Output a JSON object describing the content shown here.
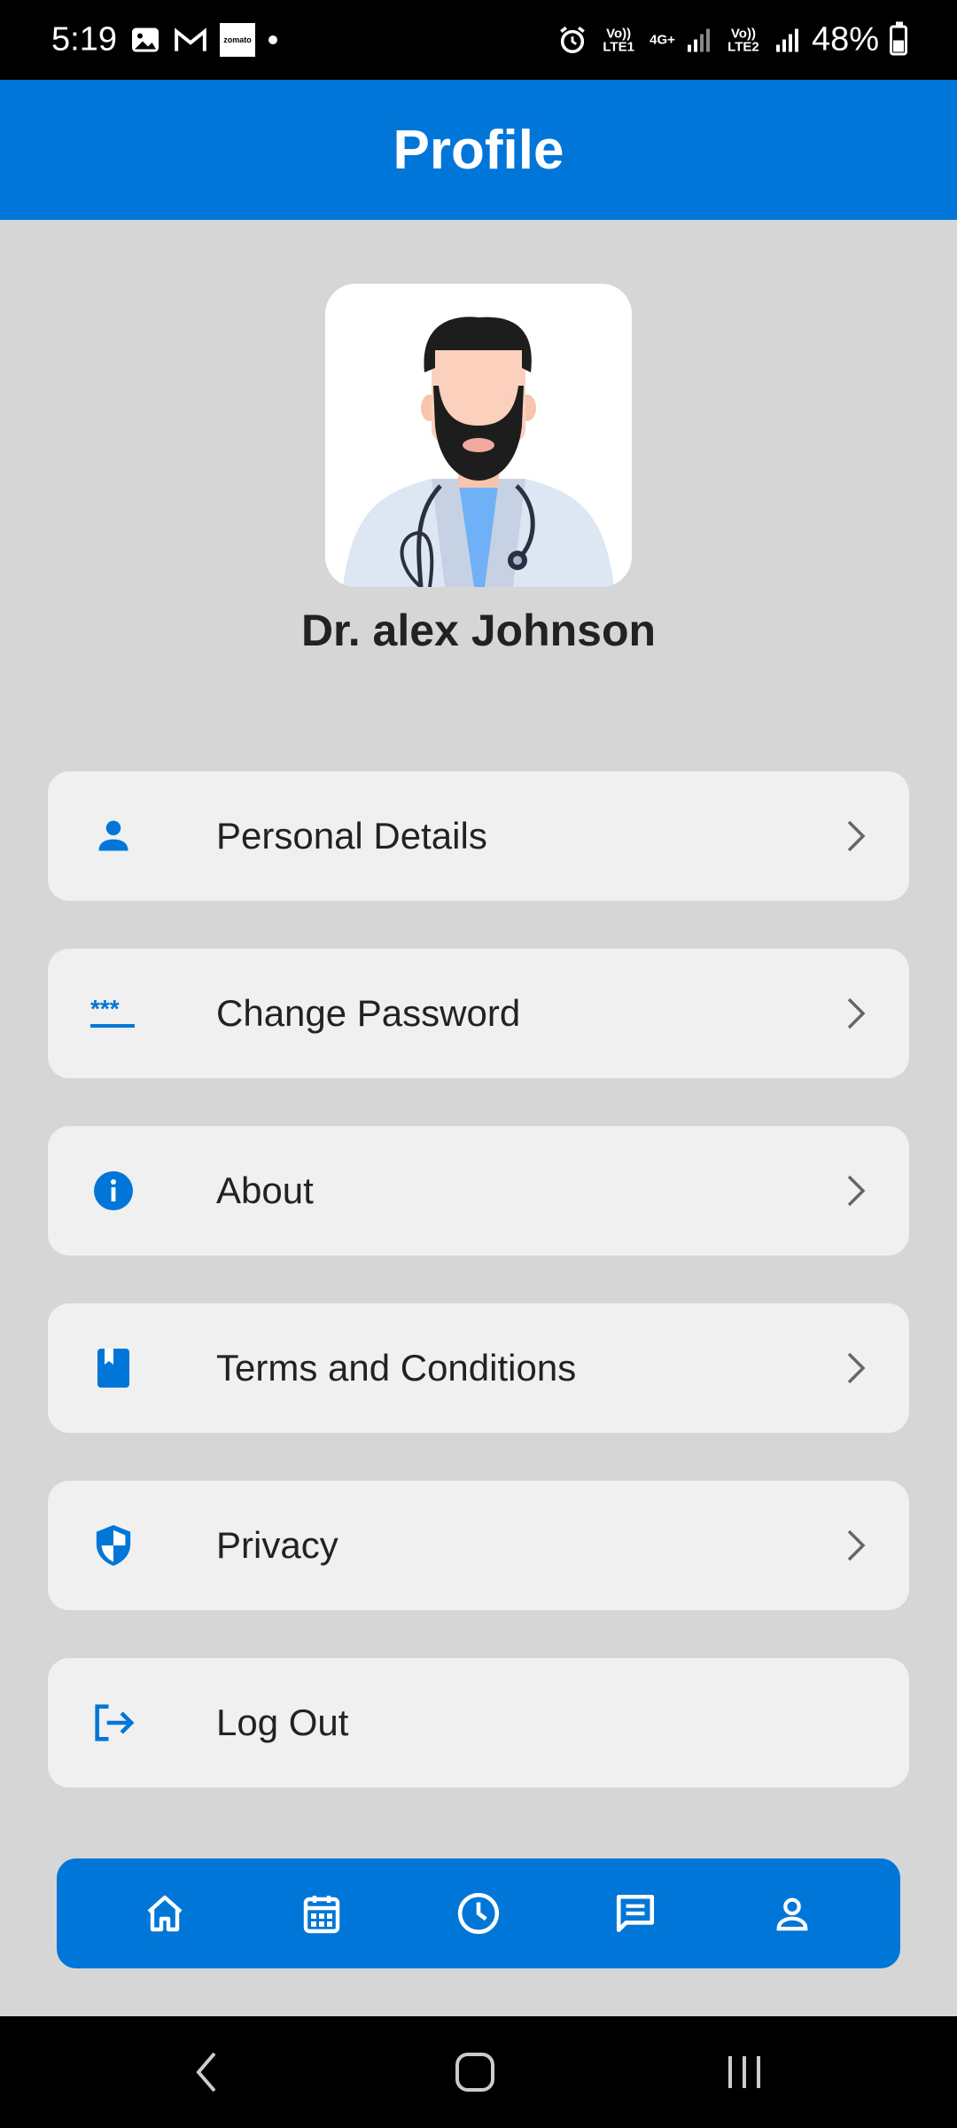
{
  "status_bar": {
    "time": "5:19",
    "network1": "Vo)) LTE1",
    "network_type": "4G+",
    "network2": "Vo)) LTE2",
    "battery": "48%",
    "zomato_label": "zomato"
  },
  "header": {
    "title": "Profile"
  },
  "profile": {
    "name": "Dr. alex Johnson"
  },
  "menu": [
    {
      "label": "Personal Details",
      "icon": "person-icon"
    },
    {
      "label": "Change Password",
      "icon": "password-icon"
    },
    {
      "label": "About",
      "icon": "info-icon"
    },
    {
      "label": "Terms and Conditions",
      "icon": "book-icon"
    },
    {
      "label": "Privacy",
      "icon": "shield-icon"
    },
    {
      "label": "Log Out",
      "icon": "logout-icon"
    }
  ],
  "bottom_nav": [
    "home-icon",
    "calendar-icon",
    "clock-icon",
    "chat-icon",
    "profile-icon"
  ],
  "colors": {
    "primary": "#0077d8",
    "background": "#d6d6d6",
    "card": "#f0f0f0"
  }
}
